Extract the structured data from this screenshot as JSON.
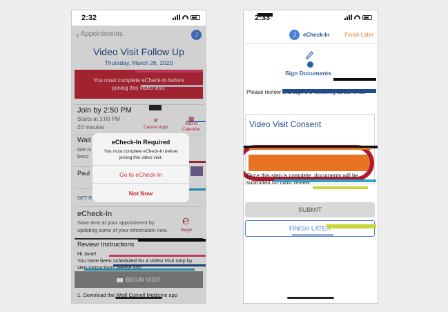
{
  "left": {
    "status": {
      "time": "2:32"
    },
    "nav": {
      "back_label": "Appointments",
      "avatar_initial": "J"
    },
    "visit": {
      "title": "Video Visit Follow Up",
      "date": "Thursday, March 26, 2020"
    },
    "banner": {
      "line1": "You must complete eCheck-In before",
      "line2": "joining this video visit."
    },
    "join": {
      "title": "Join by 2:50 PM",
      "starts": "Starts at 3:00 PM",
      "duration": "20 minutes",
      "cancel_label": "Cancel Appt",
      "addcal_line1": "Add to",
      "addcal_line2": "Calendar"
    },
    "waiting": {
      "title": "Wait",
      "text_line1": "Get m",
      "text_line2": "beco"
    },
    "provider": {
      "name": "Paul"
    },
    "get_ready": {
      "label": "GET R"
    },
    "echeckin": {
      "title": "eCheck-In",
      "description": "Save time at your appointment by updating some of your information now.",
      "begin_label": "Begin"
    },
    "review": {
      "title": "Review Instructions",
      "greeting": "Hi Jane!",
      "body": "You have been scheduled for a Video Visit step by step instructions please visit",
      "item": "1.  Download the Weill Cornell Medicine app"
    },
    "begin_visit_label": "BEGIN VISIT",
    "modal": {
      "title": "eCheck-In Required",
      "message": "You must complete eCheck-In before joining this video visit.",
      "go_label": "Go to eCheck-In",
      "not_now_label": "Not Now"
    }
  },
  "right": {
    "status": {
      "time": "2:33"
    },
    "header": {
      "avatar_initial": "J",
      "title": "eCheck-In",
      "finish_label": "Finish Later"
    },
    "step_label": "Sign Documents",
    "instructions": "Please review and sign the following documents.",
    "consent": {
      "title": "Video Visit Consent"
    },
    "once_text": "Once this step is complete, documents will be submitted for clinic review.",
    "submit_label": "SUBMIT",
    "finish_later_label": "FINISH LATER"
  },
  "colors": {
    "brand_blue": "#1f4c8c",
    "alert_red": "#c62b3b",
    "action_orange": "#e87322",
    "highlight_ring": "#b3192e"
  }
}
